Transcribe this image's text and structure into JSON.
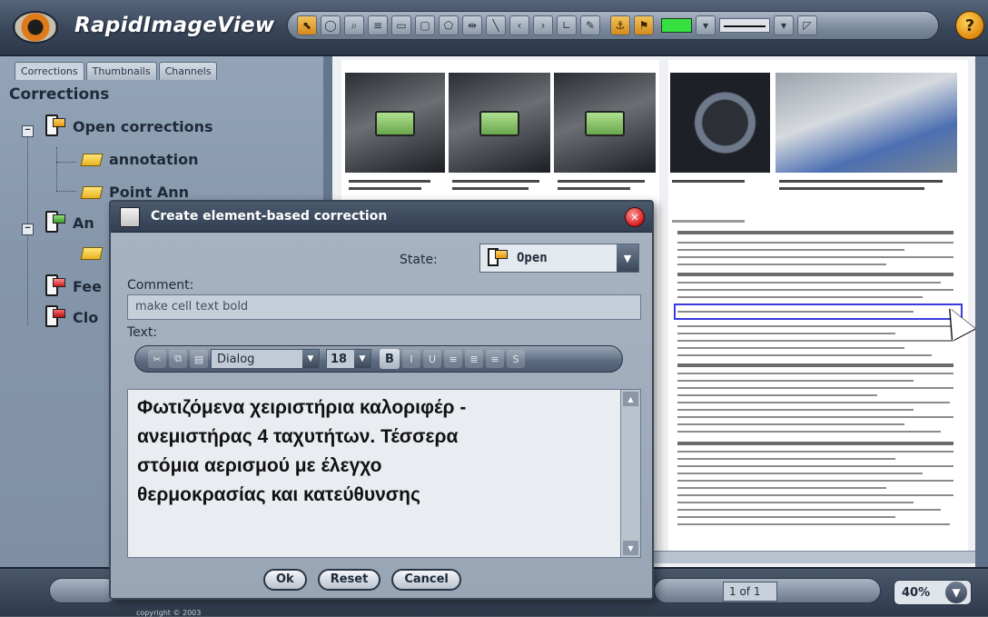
{
  "app": {
    "title_prefix": "Rapid",
    "title_suffix": "ImageView"
  },
  "toolbar": {
    "icons": [
      "select-tool-icon",
      "ellipse-tool-icon",
      "zoom-tool-icon",
      "text-tool-icon",
      "note-tool-icon",
      "rectangle-tool-icon",
      "polygon-tool-icon",
      "measure-tool-icon",
      "line-tool-icon",
      "arrow-left-tool-icon",
      "arrow-right-tool-icon",
      "angle-tool-icon",
      "pen-tool-icon",
      "anchor-tool-icon",
      "correction-tool-icon"
    ],
    "active_color": "#36e03f",
    "help_label": "?"
  },
  "left_panel": {
    "tabs": [
      {
        "label": "Corrections"
      },
      {
        "label": "Thumbnails"
      },
      {
        "label": "Channels"
      }
    ],
    "title": "Corrections",
    "tree": {
      "open": {
        "label": "Open corrections",
        "children": [
          {
            "label": "annotation"
          },
          {
            "label": "Point Ann"
          }
        ]
      },
      "partial": [
        {
          "label": "An"
        },
        {
          "label": "Fee"
        },
        {
          "label": "Clo"
        }
      ]
    }
  },
  "document": {
    "zoom": "40%",
    "page_indicator": "1 of 1"
  },
  "bottom": {
    "copyright": "copyright © 2003"
  },
  "dialog": {
    "title": "Create element-based correction",
    "state_label": "State:",
    "state_value": "Open",
    "comment_label": "Comment:",
    "comment_value": "make cell text bold",
    "text_label": "Text:",
    "font": "Dialog",
    "font_size": "18",
    "bold_label": "B",
    "text_content": "Φωτιζόμενα χειριστήρια καλοριφέρ -\nανεμιστήρας 4 ταχυτήτων. Τέσσερα\nστόμια αερισμού με έλεγχο\nθερμοκρασίας και κατεύθυνσης",
    "buttons": {
      "ok": "Ok",
      "reset": "Reset",
      "cancel": "Cancel"
    }
  }
}
